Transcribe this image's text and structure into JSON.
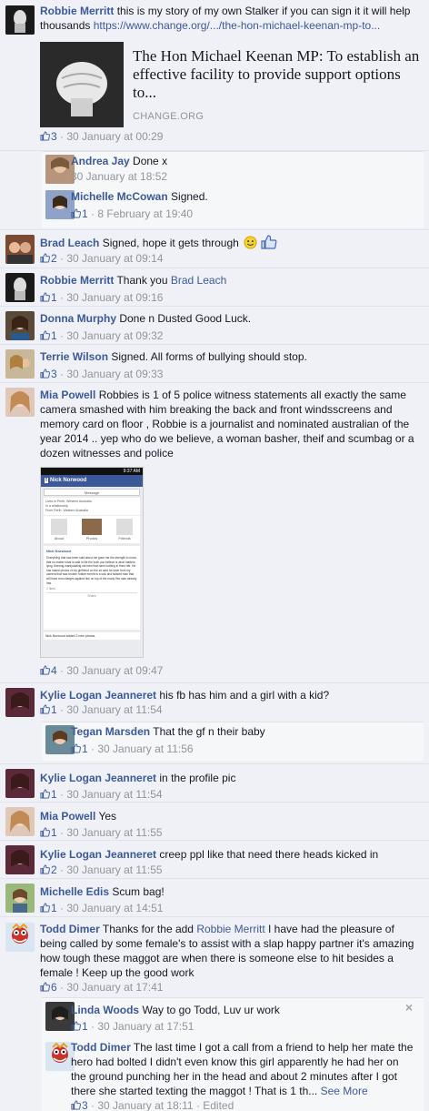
{
  "comments": [
    {
      "name": "Robbie Merritt",
      "text": "this is my story of my own Stalker if you can sign it it will help thousands",
      "link": "https://www.change.org/.../the-hon-michael-keenan-mp-to...",
      "preview": {
        "title": "The Hon Michael Keenan MP: To establish an effective facility to provide support options to...",
        "domain": "CHANGE.ORG"
      },
      "likes": "3",
      "time": "30 January at 00:29"
    },
    {
      "name": "Andrea Jay",
      "text": "Done x",
      "time": "30 January at 18:52"
    },
    {
      "name": "Michelle McCowan",
      "text": "Signed.",
      "likes": "1",
      "time": "8 February at 19:40"
    },
    {
      "name": "Brad Leach",
      "text": "Signed, hope it gets through",
      "likes": "2",
      "time": "30 January at 09:14"
    },
    {
      "name": "Robbie Merritt",
      "text": "Thank you",
      "mention": "Brad Leach",
      "likes": "1",
      "time": "30 January at 09:16"
    },
    {
      "name": "Donna Murphy",
      "text": "Done n Dusted Good Luck.",
      "likes": "1",
      "time": "30 January at 09:32"
    },
    {
      "name": "Terrie Wilson",
      "text": "Signed. All forms of bullying should stop.",
      "likes": "3",
      "time": "30 January at 09:33"
    },
    {
      "name": "Mia Powell",
      "text": "Robbies is 1 of 5 police witness statements all exactly the same camera smashed with him breaking the back and front windsscreens and memory card on floor , Robbie is a journalist and nominated australian of the year 2014 .. yep who do we believe, a woman basher, theif and scumbag or a dozen witnesses and police",
      "likes": "4",
      "time": "30 January at 09:47",
      "screenshot": {
        "status_time": "9:37 AM",
        "header_name": "Nick Norwood",
        "message_btn": "Message",
        "info": [
          "Lives in Perth, Western Australia",
          "In a relationship",
          "From Perth, Western Australia"
        ],
        "tabs": [
          "About",
          "Photos",
          "Friends"
        ],
        "post_name": "Nick Norwood",
        "post_text": "Everything that has been said about me gave me the strength to know that no matter what is said in life the truth you believe is what matters, lying, thieving manipulating old men that have nothing in there life. He has naked photos of my girlfriend on the sd card he stole from my camera that was broken robbie merritt is a sick and twisted man that will have real charges against him on top of the many this man already has.",
        "post_likes": "2 likes",
        "share": "Share",
        "footer": "Nick Norwood added 2 new photos."
      }
    },
    {
      "name": "Kylie Logan Jeanneret",
      "text": "his fb has him and a girl with a kid?",
      "likes": "1",
      "time": "30 January at 11:54"
    },
    {
      "name": "Tegan Marsden",
      "text": "That the gf n their baby",
      "likes": "1",
      "time": "30 January at 11:56"
    },
    {
      "name": "Kylie Logan Jeanneret",
      "text": "in the profile pic",
      "likes": "1",
      "time": "30 January at 11:54"
    },
    {
      "name": "Mia Powell",
      "text": "Yes",
      "likes": "1",
      "time": "30 January at 11:55"
    },
    {
      "name": "Kylie Logan Jeanneret",
      "text": "creep ppl like that need there heads kicked in",
      "likes": "2",
      "time": "30 January at 11:55"
    },
    {
      "name": "Michelle Edis",
      "text": "Scum bag!",
      "likes": "1",
      "time": "30 January at 14:51"
    },
    {
      "name": "Todd Dimer",
      "text_before": "Thanks for the add",
      "mention": "Robbie Merritt",
      "text_after": "I have had the pleasure of being called by some female's to assist with a slap happy partner it's amazing how tough these maggot are when there is someone else to hit besides a female ! Keep up the good work",
      "likes": "6",
      "time": "30 January at 17:41"
    },
    {
      "name": "Linda Woods",
      "text": "Way to go Todd, Luv ur work",
      "likes": "1",
      "time": "30 January at 17:51"
    },
    {
      "name": "Todd Dimer",
      "text": "The last time I got a call from a friend to help her mate the hero had bolted I didn't even know this girl apparently he had her on the ground punching her in the head and about 2 minutes after I got there she started texting the maggot ! That is 1 th...",
      "see_more": "See More",
      "likes": "3",
      "time": "30 January at 18:11",
      "edited": "Edited"
    }
  ],
  "ui": {
    "close": "×",
    "separator": "·"
  },
  "icons": {
    "like": "like-thumb-icon",
    "close": "close-icon",
    "smiley": "smiley-emoji-icon",
    "thumbs_up": "thumbs-up-emoji-icon"
  },
  "colors": {
    "name": "#3b5998",
    "meta": "#90949c",
    "bg": "#eff1f6",
    "reply_bg": "#f6f7f9"
  }
}
